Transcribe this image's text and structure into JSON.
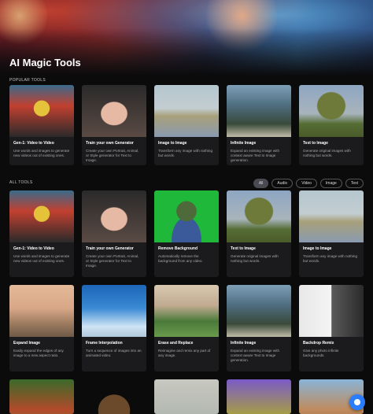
{
  "page": {
    "title": "AI Magic Tools"
  },
  "sections": {
    "popular_label": "POPULAR TOOLS",
    "all_label": "ALL TOOLS"
  },
  "filters": [
    "All",
    "Audio",
    "Video",
    "Image",
    "Text"
  ],
  "popular_tools": [
    {
      "title": "Gen-1: Video to Video",
      "desc": "Use words and images to generate new videos out of existing ones."
    },
    {
      "title": "Train your own Generator",
      "desc": "Create your own Portrait, Animal, or Style generator for Text to Image."
    },
    {
      "title": "Image to Image",
      "desc": "Transform any image with nothing but words."
    },
    {
      "title": "Infinite Image",
      "desc": "Expand an existing image with context aware Text to Image generation."
    },
    {
      "title": "Text to Image",
      "desc": "Generate original images with nothing but words."
    }
  ],
  "all_tools_row1": [
    {
      "title": "Gen-1: Video to Video",
      "desc": "Use words and images to generate new videos out of existing ones."
    },
    {
      "title": "Train your own Generator",
      "desc": "Create your own Portrait, Animal, or Style generator for Text to Image."
    },
    {
      "title": "Remove Background",
      "desc": "Automatically remove the background from any video."
    },
    {
      "title": "Text to Image",
      "desc": "Generate original images with nothing but words."
    },
    {
      "title": "Image to Image",
      "desc": "Transform any image with nothing but words."
    }
  ],
  "all_tools_row2": [
    {
      "title": "Expand Image",
      "desc": "Easily expand the edges of any image to a new aspect ratio."
    },
    {
      "title": "Frame Interpolation",
      "desc": "Turn a sequence of images into an animated video."
    },
    {
      "title": "Erase and Replace",
      "desc": "Reimagine and remix any part of any image."
    },
    {
      "title": "Infinite Image",
      "desc": "Expand an existing image with context aware Text to Image generation."
    },
    {
      "title": "Backdrop Remix",
      "desc": "Give any photo infinite backgrounds."
    }
  ]
}
